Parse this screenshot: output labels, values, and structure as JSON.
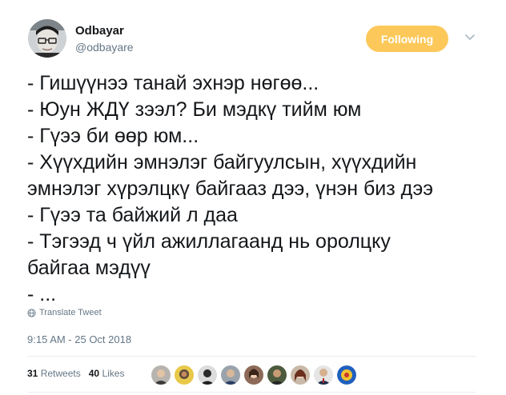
{
  "author": {
    "display_name": "Odbayar",
    "handle": "@odbayare",
    "avatar_icon": "user-avatar"
  },
  "follow_button": {
    "label": "Following",
    "color": "#fcc85a"
  },
  "menu": {
    "icon": "chevron-down-icon"
  },
  "tweet": {
    "lines": [
      "- Гишүүнээ танай эхнэр нөгөө...",
      "- Юун ЖДҮ зээл? Би мэдкү тийм юм",
      "- Гүээ би өөр юм...",
      "- Хүүхдийн эмнэлэг байгуулсын, хүүхдийн",
      "эмнэлэг хүрэлцкү байгааз дээ, үнэн биз дээ",
      "- Гүээ та байжий л даа",
      "- Тэгээд ч үйл ажиллагаанд нь оролцку",
      "байгаа мэдүү",
      "- ..."
    ]
  },
  "translate": {
    "label": "Translate Tweet",
    "icon": "globe-icon"
  },
  "timestamp": "9:15 AM - 25 Oct 2018",
  "stats": {
    "retweets_count": "31",
    "retweets_label": "Retweets",
    "likes_count": "40",
    "likes_label": "Likes"
  },
  "likers": [
    {
      "icon": "liker-avatar-1"
    },
    {
      "icon": "liker-avatar-2"
    },
    {
      "icon": "liker-avatar-3"
    },
    {
      "icon": "liker-avatar-4"
    },
    {
      "icon": "liker-avatar-5"
    },
    {
      "icon": "liker-avatar-6"
    },
    {
      "icon": "liker-avatar-7"
    },
    {
      "icon": "liker-avatar-8"
    },
    {
      "icon": "liker-avatar-9"
    }
  ]
}
